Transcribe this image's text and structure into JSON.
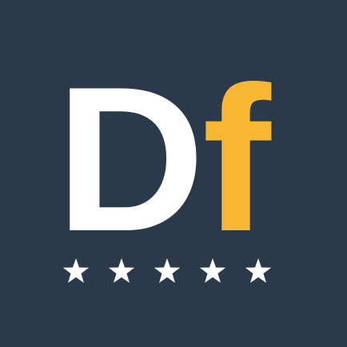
{
  "logo": {
    "letter_primary": "D",
    "letter_secondary": "f",
    "color_primary": "#ffffff",
    "color_secondary": "#f7b733",
    "background": "#2b3a4a"
  },
  "rating": {
    "stars_total": 5,
    "stars_filled": 5,
    "star_color": "#ffffff",
    "icon": "star-icon"
  }
}
